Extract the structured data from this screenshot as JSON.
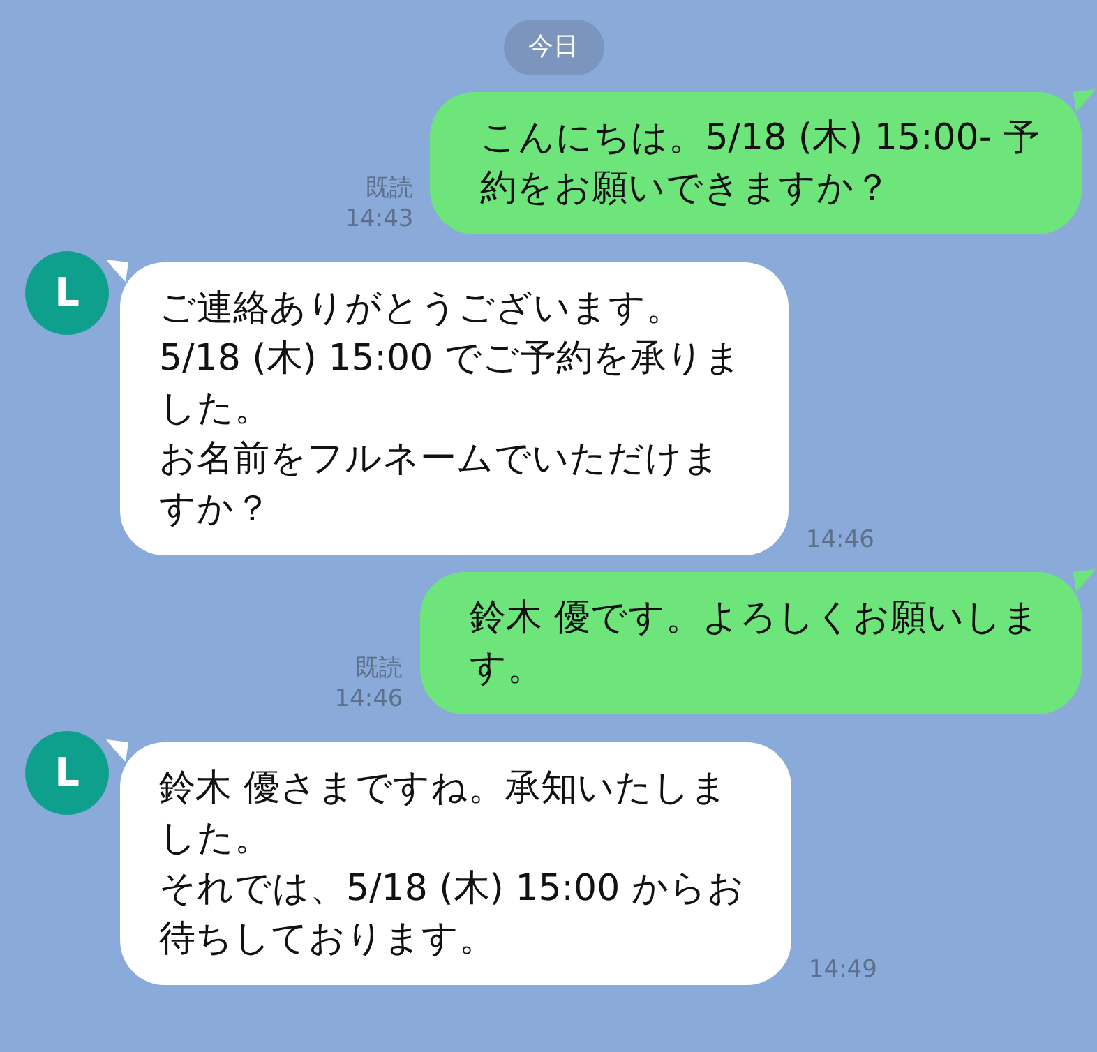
{
  "date_label": "今日",
  "messages": [
    {
      "kind": "sent",
      "lines": [
        "こんにちは。5/18 (木) 15:00- 予",
        "約をお願いできますか？"
      ],
      "read": "既読",
      "time": "14:43"
    },
    {
      "kind": "received",
      "avatar": "L",
      "lines": [
        "ご連絡ありがとうございます。",
        "5/18 (木) 15:00 でご予約を承りま",
        "した。",
        "お名前をフルネームでいただけま",
        "すか？"
      ],
      "time": "14:46"
    },
    {
      "kind": "sent",
      "lines": [
        "鈴木 優です。よろしくお願いしま",
        "す。"
      ],
      "read": "既読",
      "time": "14:46"
    },
    {
      "kind": "received",
      "avatar": "L",
      "lines": [
        "鈴木 優さまですね。承知いたしま",
        "した。",
        "それでは、5/18 (木) 15:00 からお",
        "待ちしております。"
      ],
      "time": "14:49"
    }
  ]
}
